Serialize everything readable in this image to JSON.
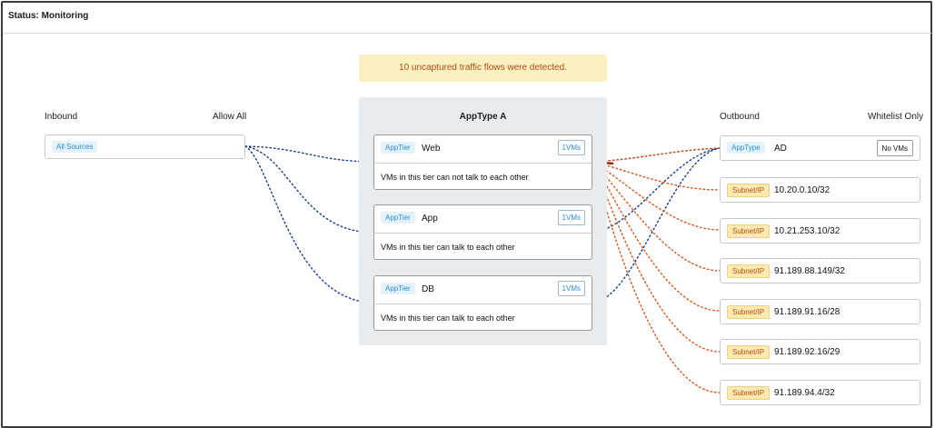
{
  "status": {
    "text": "Status: Monitoring"
  },
  "alert": {
    "text": "10 uncaptured traffic flows were detected."
  },
  "inbound": {
    "title": "Inbound",
    "policy": "Allow All",
    "source": {
      "tag": "All Sources"
    }
  },
  "app": {
    "title": "AppType A",
    "tiers": [
      {
        "tag": "AppTier",
        "name": "Web",
        "vms": "1VMs",
        "desc": "VMs in this tier can not talk to each other"
      },
      {
        "tag": "AppTier",
        "name": "App",
        "vms": "1VMs",
        "desc": "VMs in this tier can talk to each other"
      },
      {
        "tag": "AppTier",
        "name": "DB",
        "vms": "1VMs",
        "desc": "VMs in this tier can talk to each other"
      }
    ]
  },
  "outbound": {
    "title": "Outbound",
    "policy": "Whitelist Only",
    "apptype": {
      "tag": "AppType",
      "name": "AD",
      "vms": "No VMs"
    },
    "subnets": [
      {
        "tag": "Subnet/IP",
        "value": "10.20.0.10/32"
      },
      {
        "tag": "Subnet/IP",
        "value": "10.21.253.10/32"
      },
      {
        "tag": "Subnet/IP",
        "value": "91.189.88.149/32"
      },
      {
        "tag": "Subnet/IP",
        "value": "91.189.91.16/28"
      },
      {
        "tag": "Subnet/IP",
        "value": "91.189.92.16/29"
      },
      {
        "tag": "Subnet/IP",
        "value": "91.189.94.4/32"
      }
    ]
  },
  "colors": {
    "allowed_link": "#1b3a8c",
    "uncaptured_link": "#d9541a",
    "accent_blue": "#2a8dd6"
  }
}
